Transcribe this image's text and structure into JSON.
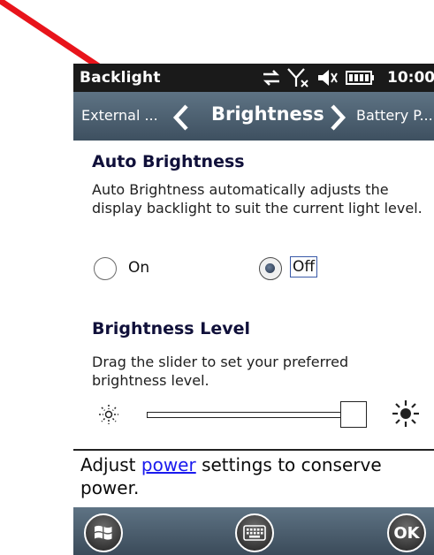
{
  "status_bar": {
    "title": "Backlight",
    "time": "10:00",
    "icons": [
      "sync-icon",
      "signal-off-icon",
      "speaker-muted-icon",
      "battery-icon"
    ]
  },
  "header": {
    "prev_label": "External ...",
    "title": "Brightness",
    "next_label": "Battery P..."
  },
  "auto_brightness": {
    "title": "Auto Brightness",
    "description": "Auto Brightness automatically adjusts the display backlight to suit the current light level.",
    "options": [
      {
        "label": "On",
        "selected": false
      },
      {
        "label": "Off",
        "selected": true
      }
    ]
  },
  "brightness_level": {
    "title": "Brightness Level",
    "description": "Drag the slider to set your preferred brightness level.",
    "value_fraction": 1.0
  },
  "footer": {
    "text_before": "Adjust ",
    "link": "power",
    "text_after": " settings to conserve power."
  },
  "bottom_bar": {
    "ok_label": "OK"
  },
  "colors": {
    "annotation_arrow": "#e8141b",
    "link": "#1a1aee",
    "header_gradient_top": "#5e7384",
    "header_gradient_bottom": "#3e5060"
  }
}
